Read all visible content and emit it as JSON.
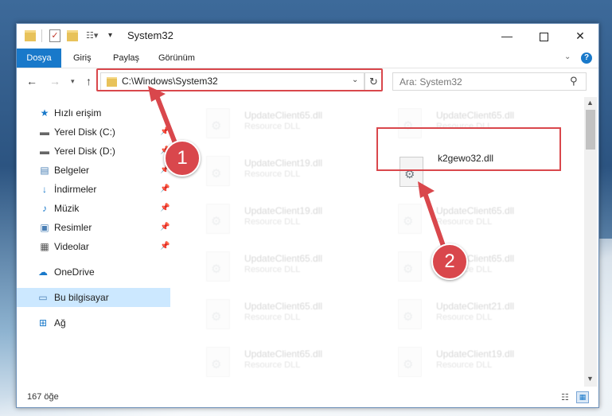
{
  "window": {
    "title": "System32"
  },
  "ribbon": {
    "tabs": [
      "Dosya",
      "Giriş",
      "Paylaş",
      "Görünüm"
    ]
  },
  "address": {
    "path": "C:\\Windows\\System32",
    "search_placeholder": "Ara: System32"
  },
  "sidebar": {
    "items": [
      {
        "label": "Hızlı erişim",
        "icon": "star-icon"
      },
      {
        "label": "Yerel Disk (C:)",
        "icon": "drive-icon",
        "pinned": true
      },
      {
        "label": "Yerel Disk (D:)",
        "icon": "drive-icon",
        "pinned": true
      },
      {
        "label": "Belgeler",
        "icon": "documents-icon",
        "pinned": true
      },
      {
        "label": "İndirmeler",
        "icon": "download-icon",
        "pinned": true
      },
      {
        "label": "Müzik",
        "icon": "music-icon",
        "pinned": true
      },
      {
        "label": "Resimler",
        "icon": "pictures-icon",
        "pinned": true
      },
      {
        "label": "Videolar",
        "icon": "videos-icon",
        "pinned": true
      },
      {
        "label": "OneDrive",
        "icon": "cloud-icon"
      },
      {
        "label": "Bu bilgisayar",
        "icon": "computer-icon",
        "selected": true
      },
      {
        "label": "Ağ",
        "icon": "network-icon"
      }
    ]
  },
  "files": {
    "col1": [
      {
        "name": "UpdateClient65.dll",
        "type": "Resource DLL"
      },
      {
        "name": "UpdateClient19.dll",
        "type": "Resource DLL"
      },
      {
        "name": "UpdateClient19.dll",
        "type": "Resource DLL"
      },
      {
        "name": "UpdateClient65.dll",
        "type": "Resource DLL"
      },
      {
        "name": "UpdateClient65.dll",
        "type": "Resource DLL"
      },
      {
        "name": "UpdateClient65.dll",
        "type": "Resource DLL"
      }
    ],
    "col2": [
      {
        "name": "UpdateClient65.dll",
        "type": "Resource DLL"
      },
      {
        "name": "k2gewo32.dll",
        "type": ""
      },
      {
        "name": "UpdateClient65.dll",
        "type": "Resource DLL"
      },
      {
        "name": "UpdateClient65.dll",
        "type": "Resource DLL"
      },
      {
        "name": "UpdateClient21.dll",
        "type": "Resource DLL"
      },
      {
        "name": "UpdateClient19.dll",
        "type": "Resource DLL"
      }
    ]
  },
  "status": {
    "item_count": "167 öğe"
  },
  "annotations": {
    "badge1": "1",
    "badge2": "2",
    "color": "#d9474c"
  }
}
